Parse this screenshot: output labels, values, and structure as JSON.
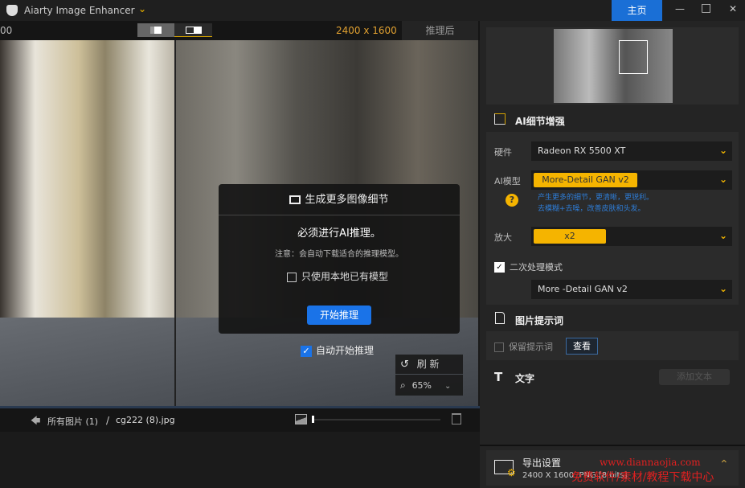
{
  "titlebar": {
    "app_name": "Aiarty Image Enhancer",
    "home_button": "主页",
    "minimize": "—",
    "maximize": "□",
    "close": "✕"
  },
  "topbar": {
    "left_zoom_fragment": "00",
    "resolution": "2400 x 1600",
    "after_label": "推理后"
  },
  "dialog": {
    "title": "生成更多图像细节",
    "heading": "必须进行AI推理。",
    "note": "注意：会自动下载适合的推理模型。",
    "local_only_label": "只使用本地已有模型",
    "local_only_checked": false,
    "start_button": "开始推理",
    "auto_start_label": "自动开始推理",
    "auto_start_checked": true
  },
  "viewer": {
    "refresh_label": "刷 新",
    "zoom": "65%"
  },
  "bottombar": {
    "all_images": "所有图片 (1)",
    "separator": "/",
    "filename": "cg222 (8).jpg"
  },
  "panel": {
    "ai_section": "AI细节增强",
    "hardware_label": "硬件",
    "hardware_value": "Radeon RX 5500 XT",
    "model_label": "AI模型",
    "model_value": "More-Detail GAN v2",
    "model_desc_1": "产生更多的细节，更清晰，更锐利。",
    "model_desc_2": "去模糊+去噪，改善皮肤和头发。",
    "scale_label": "放大",
    "scale_value": "x2",
    "secondary_label": "二次处理模式",
    "secondary_checked": true,
    "secondary_value": "More -Detail GAN v2",
    "prompt_section": "图片提示词",
    "keep_prompt_label": "保留提示词",
    "keep_prompt_checked": false,
    "view_button": "查看",
    "text_section": "文字",
    "add_text_button": "添加文本",
    "export_title": "导出设置",
    "export_info": "2400 X 1600  PNG [8 bits]"
  },
  "watermark": {
    "line1": "www.diannaojia.com",
    "line2": "免费软件/素材/教程下载中心"
  },
  "colors": {
    "accent": "#f5b400",
    "primary_button": "#1a73e8",
    "home": "#1a6fd6"
  }
}
